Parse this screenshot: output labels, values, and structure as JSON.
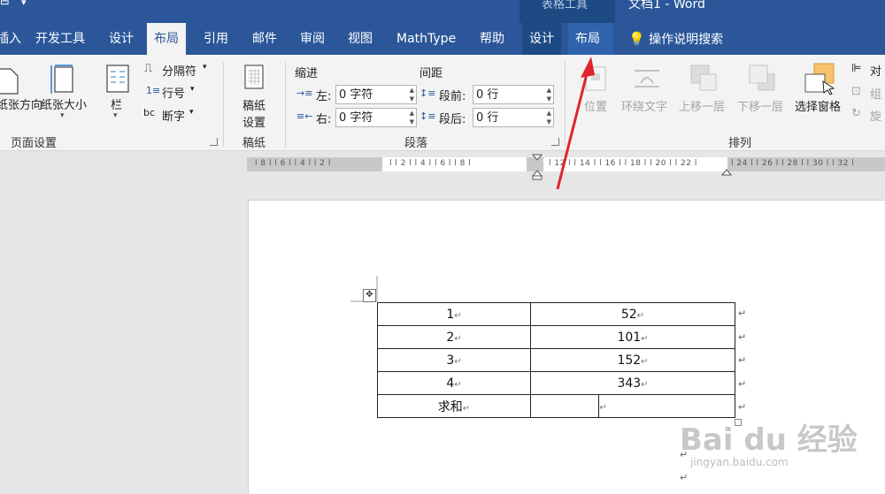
{
  "window": {
    "qat_icon": "save-icon",
    "context_title": "表格工具",
    "doc_title": "文档1  -  Word"
  },
  "tabs": {
    "insert": "插入",
    "developer": "开发工具",
    "design": "设计",
    "layout": "布局",
    "references": "引用",
    "mailings": "邮件",
    "review": "审阅",
    "view": "视图",
    "mathtype": "MathType",
    "help": "帮助",
    "table_design": "设计",
    "table_layout": "布局",
    "tell_me": "操作说明搜索"
  },
  "page_setup": {
    "orientation": "纸张方向",
    "size": "纸张大小",
    "columns": "栏",
    "breaks": "分隔符",
    "line_numbers": "行号",
    "hyphenation": "断字",
    "label": "页面设置"
  },
  "manuscript": {
    "button_line1": "稿纸",
    "button_line2": "设置",
    "label": "稿纸"
  },
  "paragraph": {
    "indent_header": "缩进",
    "spacing_header": "间距",
    "left_label": "左:",
    "left_value": "0 字符",
    "right_label": "右:",
    "right_value": "0 字符",
    "before_label": "段前:",
    "before_value": "0 行",
    "after_label": "段后:",
    "after_value": "0 行",
    "label": "段落"
  },
  "arrange": {
    "position": "位置",
    "wrap_text": "环绕文字",
    "bring_forward": "上移一层",
    "send_backward": "下移一层",
    "selection_pane": "选择窗格",
    "align": "对",
    "group": "组",
    "rotate": "旋",
    "label": "排列"
  },
  "ruler": {
    "left_ticks": "l 8 l   l 6 l   l 4 l   l 2 l",
    "mid_ticks": "l   l 2 l   l 4 l   l 6 l   l 8 l",
    "right_ticks": "l 12 l  l 14 l  l 16 l  l 18 l  l 20 l  l 22 l",
    "far_ticks": "l 24 l  l 26 l  l 28 l  l 30 l  l 32 l"
  },
  "table": {
    "rows": [
      {
        "left": "1",
        "right": "52"
      },
      {
        "left": "2",
        "right": "101"
      },
      {
        "left": "3",
        "right": "152"
      },
      {
        "left": "4",
        "right": "343"
      },
      {
        "left": "求和",
        "right": ""
      }
    ],
    "paragraph_mark": "↵"
  },
  "watermark": {
    "text": "Bai du 经验",
    "sub": "jingyan.baidu.com"
  },
  "colors": {
    "ribbon_blue": "#2b579a",
    "context_band": "#1e4a84",
    "arrow_red": "#e0242c"
  }
}
